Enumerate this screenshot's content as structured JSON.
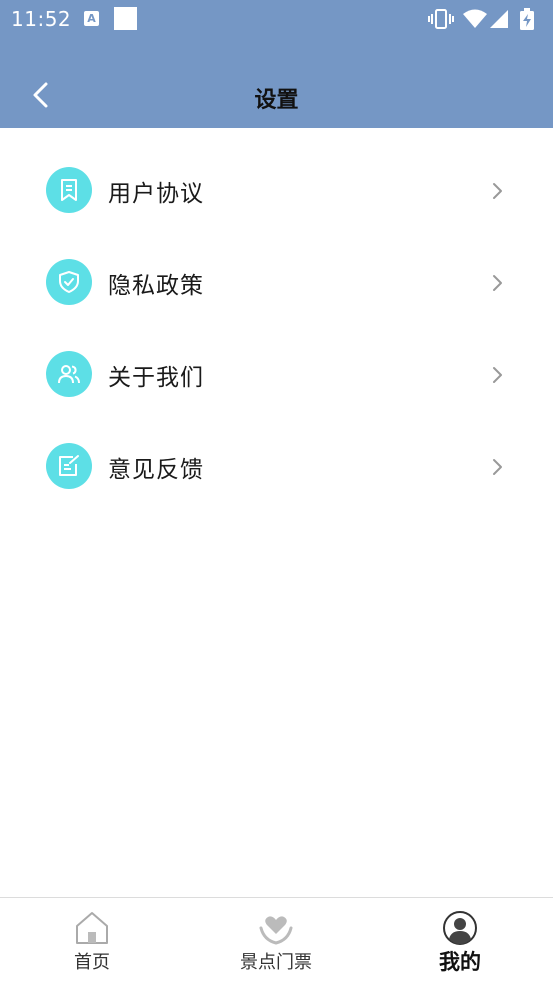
{
  "status_bar": {
    "time": "11:52",
    "icons": [
      "a-notification-icon",
      "square-notification-icon",
      "vibrate-icon",
      "wifi-icon",
      "signal-icon",
      "battery-charging-icon"
    ]
  },
  "header": {
    "title": "设置",
    "back_icon": "chevron-left-icon"
  },
  "menu": {
    "items": [
      {
        "label": "用户协议",
        "icon": "bookmark-doc-icon"
      },
      {
        "label": "隐私政策",
        "icon": "shield-check-icon"
      },
      {
        "label": "关于我们",
        "icon": "users-icon"
      },
      {
        "label": "意见反馈",
        "icon": "edit-note-icon"
      }
    ]
  },
  "tab_bar": {
    "tabs": [
      {
        "label": "首页",
        "icon": "home-icon",
        "active": false
      },
      {
        "label": "景点门票",
        "icon": "heart-hand-icon",
        "active": false
      },
      {
        "label": "我的",
        "icon": "profile-icon",
        "active": true
      }
    ]
  },
  "colors": {
    "header_bg": "#7597c5",
    "icon_bg": "#5ddfe6",
    "background": "#ffffff"
  }
}
